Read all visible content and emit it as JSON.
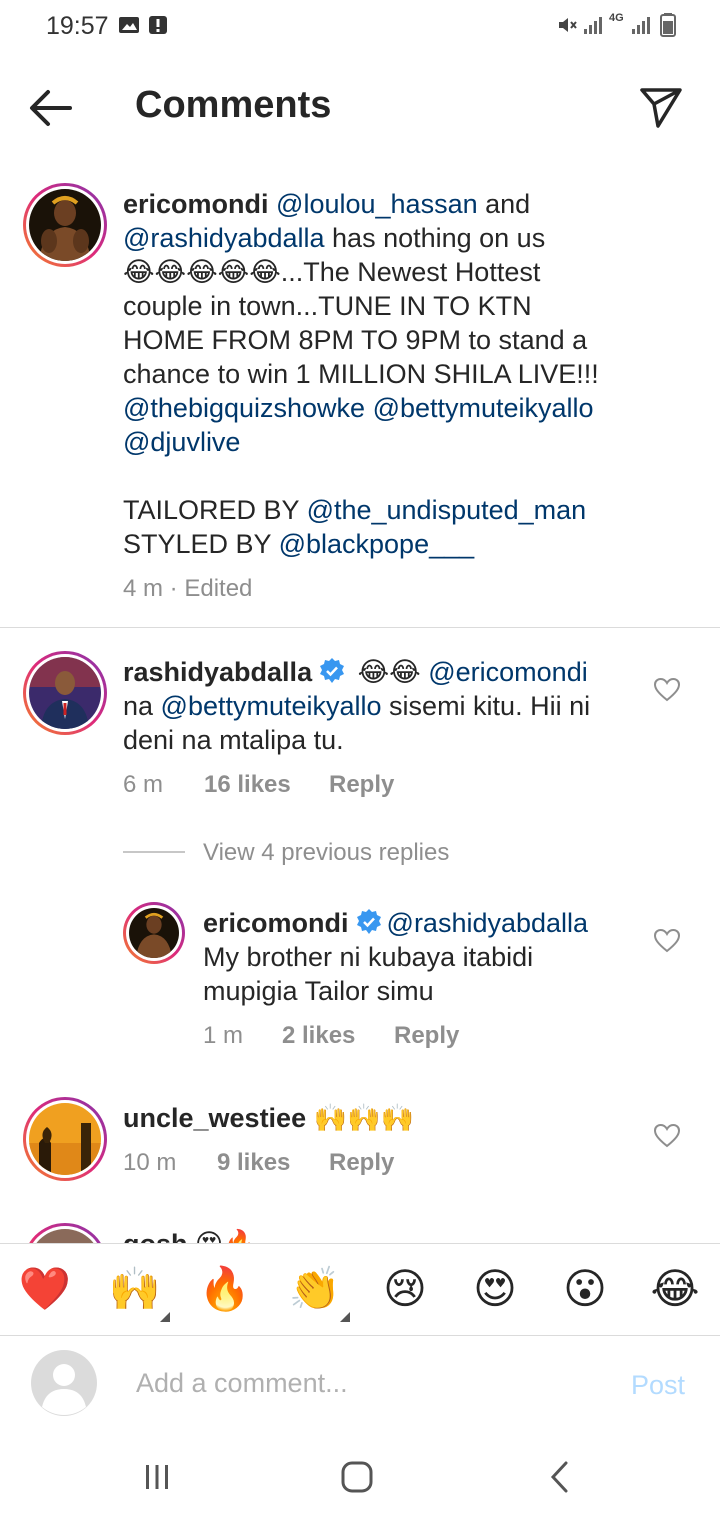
{
  "status_bar": {
    "time": "19:57",
    "network_label": "4G"
  },
  "header": {
    "title": "Comments"
  },
  "post_caption": {
    "username": "ericomondi",
    "m1": "@loulou_hassan",
    "t1": " and ",
    "m2": "@rashidyabdalla",
    "t2": " has nothing on us",
    "emojis": "😂😂😂😂😂",
    "t3": "...The Newest Hottest",
    "line4": "couple in town...TUNE IN TO KTN",
    "line5": "HOME FROM 8PM TO 9PM to stand a",
    "line6": "chance to win 1 MILLION SHILA LIVE!!!",
    "m3": "@thebigquizshowke",
    "m4": "@bettymuteikyallo",
    "m5": "@djuvlive",
    "tailored_label": "TAILORED BY ",
    "tailored_mention": "@the_undisputed_man",
    "styled_label": "STYLED BY ",
    "styled_mention": "@blackpope___",
    "meta": "4 m · Edited"
  },
  "comments": [
    {
      "username": "rashidyabdalla",
      "emojis": "😂😂",
      "m1": "@ericomondi",
      "t1": "na ",
      "m2": "@bettymuteikyallo",
      "t2": " sisemi kitu. Hii ni",
      "t3": "deni na mtalipa tu.",
      "time": "6 m",
      "likes": "16 likes",
      "reply": "Reply"
    },
    {
      "username": "uncle_westiee",
      "emojis": "🙌🙌🙌",
      "time": "10 m",
      "likes": "9 likes",
      "reply": "Reply"
    },
    {
      "username": "gosh",
      "emojis": "😍🔥"
    }
  ],
  "view_replies": "View 4 previous replies",
  "reply": {
    "username": "ericomondi",
    "mention": "@rashidyabdalla",
    "line1": "My brother ni kubaya itabidi",
    "line2": "mupigia Tailor simu",
    "time": "1 m",
    "likes": "2 likes",
    "reply": "Reply"
  },
  "emoji_bar": [
    "❤️",
    "🙌",
    "🔥",
    "👏",
    "😢",
    "😍",
    "😮",
    "😂"
  ],
  "composer": {
    "placeholder": "Add a comment...",
    "post_label": "Post"
  },
  "colors": {
    "mention": "#00376b",
    "meta": "#8e8e8e",
    "post_disabled": "#b3dbff"
  }
}
